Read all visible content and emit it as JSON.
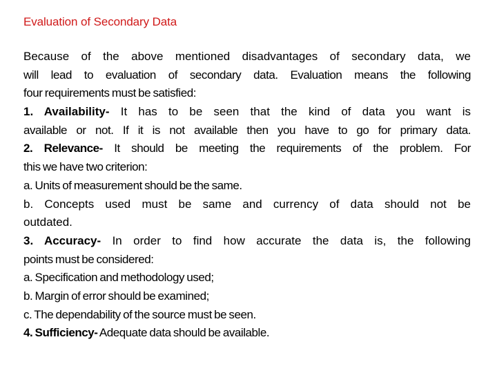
{
  "slide": {
    "title": "Evaluation of Secondary Data",
    "title_color": "#d01a1a",
    "lines": [
      {
        "label": "",
        "text": "Because of the above mentioned disadvantages of secondary data, we"
      },
      {
        "label": "",
        "text": "will lead to evaluation of secondary data. Evaluation means the following"
      },
      {
        "label": "",
        "text": "four requirements must be satisfied:"
      },
      {
        "label": "1. Availability-",
        "text": " It has to be seen that the kind of data you want is"
      },
      {
        "label": "",
        "text": "available or not. If it is not available then you have to go for primary data."
      },
      {
        "label": "2. Relevance-",
        "text": " It should be meeting the requirements of the problem. For"
      },
      {
        "label": "",
        "text": "this we have two criterion:"
      },
      {
        "label": "",
        "text": "a. Units of measurement should be the same."
      },
      {
        "label": "",
        "text": "b. Concepts used must be same and currency of data should not be"
      },
      {
        "label": "",
        "text": "outdated."
      },
      {
        "label": "3. Accuracy-",
        "text": " In order to find how accurate the data is, the following"
      },
      {
        "label": "",
        "text": "points must be considered:"
      },
      {
        "label": "",
        "text": "a. Specification and methodology used;"
      },
      {
        "label": "",
        "text": "b. Margin of error should be examined;"
      },
      {
        "label": "",
        "text": "c. The dependability of the source must be seen."
      },
      {
        "label": "4. Sufficiency-",
        "text": " Adequate data should be available."
      }
    ]
  }
}
